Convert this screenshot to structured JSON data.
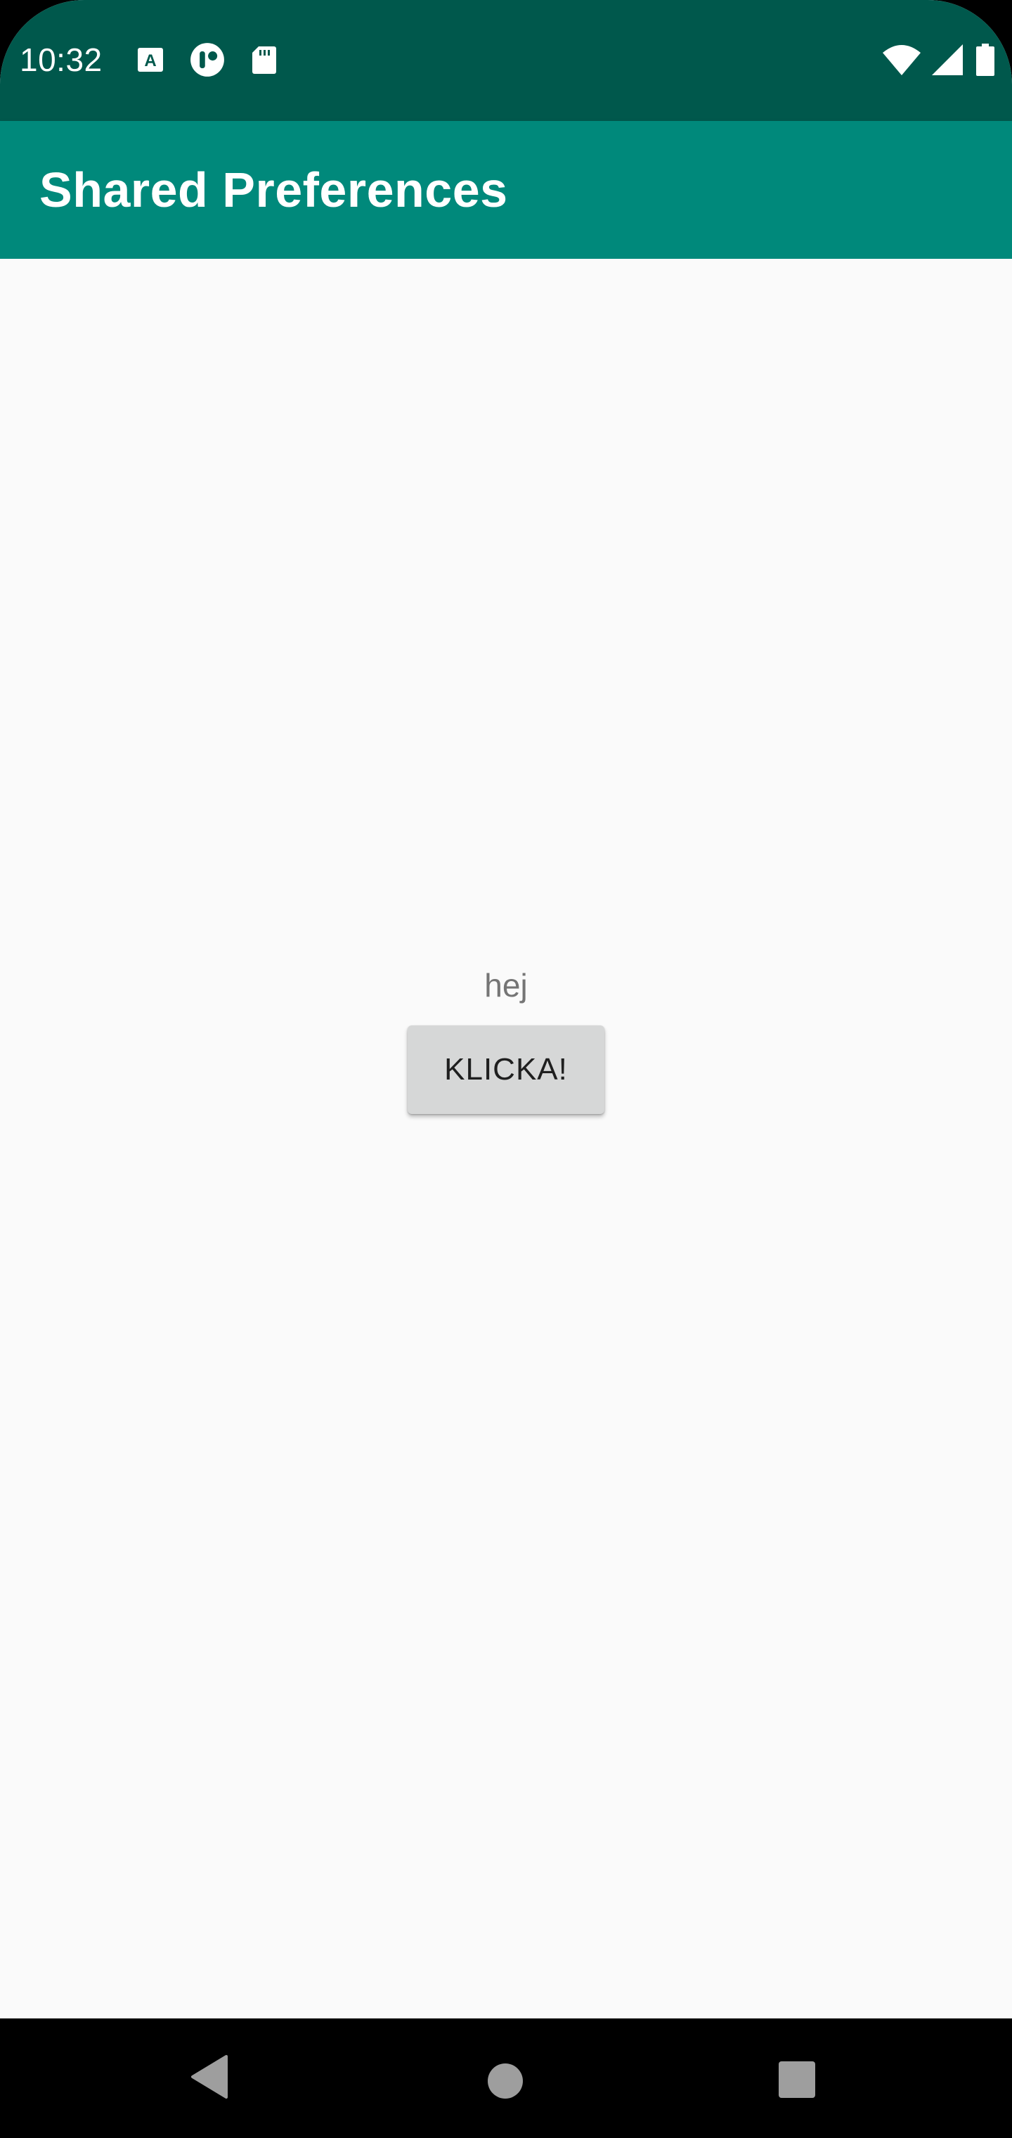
{
  "status_bar": {
    "time": "10:32",
    "left_icons": [
      "text-a-icon",
      "notification-dot-icon",
      "sd-card-icon"
    ],
    "right_icons": [
      "wifi-icon",
      "cell-signal-icon",
      "battery-icon"
    ]
  },
  "app_bar": {
    "title": "Shared Preferences"
  },
  "main": {
    "text": "hej",
    "button_label": "KLICKA!"
  },
  "nav_bar": {
    "icons": [
      "back-icon",
      "home-icon",
      "recents-icon"
    ]
  },
  "colors": {
    "status_bar": "#00584c",
    "app_bar": "#00897b",
    "background": "#fafafa",
    "button": "#d6d7d7"
  }
}
